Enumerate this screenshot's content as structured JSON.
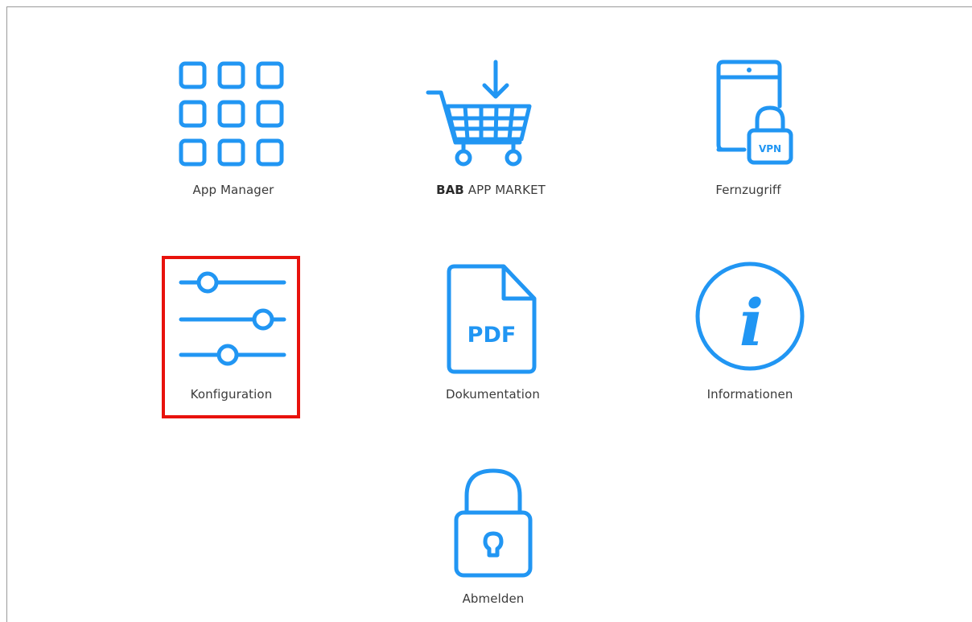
{
  "accent_color": "#2196f3",
  "highlight_color": "#e8120c",
  "tiles": [
    {
      "id": "app-manager",
      "label": "App Manager",
      "icon": "grid-icon"
    },
    {
      "id": "app-market",
      "label_bold": "BAB",
      "label_rest": " APP MARKET",
      "icon": "shopping-cart-icon"
    },
    {
      "id": "remote-access",
      "label": "Fernzugriff",
      "icon": "phone-vpn-lock-icon",
      "badge": "VPN"
    },
    {
      "id": "configuration",
      "label": "Konfiguration",
      "icon": "sliders-icon",
      "highlighted": true
    },
    {
      "id": "documentation",
      "label": "Dokumentation",
      "icon": "pdf-file-icon",
      "badge": "PDF"
    },
    {
      "id": "information",
      "label": "Informationen",
      "icon": "info-icon",
      "glyph": "i"
    },
    {
      "id": "logout",
      "label": "Abmelden",
      "icon": "padlock-icon"
    }
  ]
}
